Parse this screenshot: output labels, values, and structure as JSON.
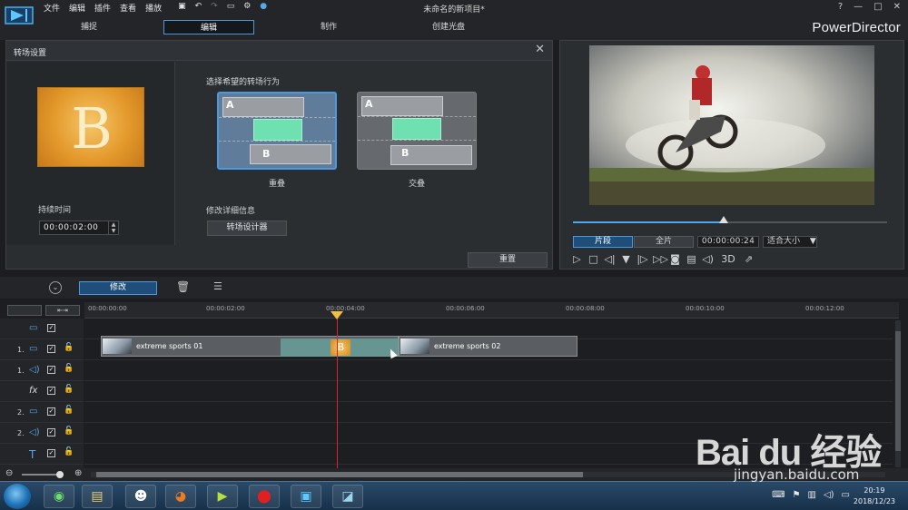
{
  "menu": [
    "文件",
    "编辑",
    "插件",
    "查看",
    "播放"
  ],
  "window_title": "未命名的新项目*",
  "brand": "PowerDirector",
  "window_controls": [
    "?",
    "—",
    "□",
    "✕"
  ],
  "tabs": [
    {
      "label": "捕捉",
      "active": false
    },
    {
      "label": "编辑",
      "active": true
    },
    {
      "label": "制作",
      "active": false
    },
    {
      "label": "创建光盘",
      "active": false
    }
  ],
  "transition_panel": {
    "title": "转场设置",
    "close": "✕",
    "thumb_letter": "B",
    "duration_label": "持续时间",
    "duration_value": "00:00:02:00",
    "choose_label": "选择希望的转场行为",
    "options": [
      {
        "name": "重叠",
        "a": "A",
        "b": "B",
        "selected": true
      },
      {
        "name": "交叠",
        "a": "A",
        "b": "B",
        "selected": false
      }
    ],
    "modify_label": "修改详细信息",
    "designer_button": "转场设计器",
    "reset_button": "重置"
  },
  "preview": {
    "progress": 0.48,
    "seg_clip": "片段",
    "seg_full": "全片",
    "timecode": "00:00:00:24",
    "fit": "适合大小",
    "three_d": "3D"
  },
  "toolbar": {
    "modify_button": "修改"
  },
  "timeline": {
    "ruler": [
      "00:00:00:00",
      "00:00:02:00",
      "00:00:04:00",
      "00:00:06:00",
      "00:00:08:00",
      "00:00:10:00",
      "00:00:12:00"
    ],
    "tracks": [
      {
        "num": "",
        "icon": "video-track-icon"
      },
      {
        "num": "1.",
        "icon": "video-track-icon"
      },
      {
        "num": "1.",
        "icon": "audio-track-icon"
      },
      {
        "num": "",
        "icon": "fx-track-icon",
        "glyph": "fx"
      },
      {
        "num": "2.",
        "icon": "video-track-icon"
      },
      {
        "num": "2.",
        "icon": "audio-track-icon"
      },
      {
        "num": "",
        "icon": "title-track-icon",
        "glyph": "T"
      }
    ],
    "clip1": "extreme sports 01",
    "clip2": "extreme sports 02"
  },
  "taskbar": {
    "time": "20:19",
    "date": "2018/12/23"
  },
  "watermark": {
    "text": "Bai du 经验",
    "url": "jingyan.baidu.com"
  },
  "colors": {
    "accent": "#4a98e0",
    "transition_thumb": "#e49a2c",
    "playhead": "#d02828"
  }
}
